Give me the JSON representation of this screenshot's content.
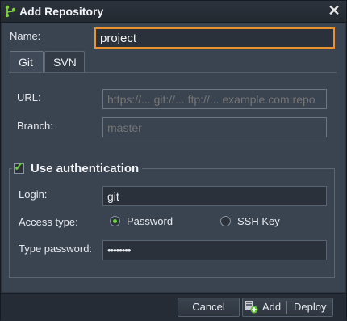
{
  "dialog": {
    "title": "Add Repository",
    "close_glyph": "✕"
  },
  "name_field": {
    "label": "Name:",
    "value": "project"
  },
  "tabs": [
    {
      "label": "Git",
      "active": true
    },
    {
      "label": "SVN",
      "active": false
    }
  ],
  "url_field": {
    "label": "URL:",
    "placeholder": "https://... git://... ftp://... example.com:repo"
  },
  "branch_field": {
    "label": "Branch:",
    "placeholder": "master"
  },
  "auth": {
    "label": "Use authentication",
    "checked": true,
    "login": {
      "label": "Login:",
      "value": "git"
    },
    "access_type": {
      "label": "Access type:",
      "options": [
        {
          "label": "Password",
          "selected": true
        },
        {
          "label": "SSH Key",
          "selected": false
        }
      ]
    },
    "password": {
      "label": "Type password:",
      "value": "••••••••"
    }
  },
  "footer": {
    "cancel_label": "Cancel",
    "add_deploy_icon": "add-deploy-icon",
    "add_label": "Add",
    "deploy_label": "Deploy"
  },
  "colors": {
    "focus_border": "#e9922f",
    "check_green": "#6fcf3f",
    "panel_bg": "#3a4350"
  }
}
